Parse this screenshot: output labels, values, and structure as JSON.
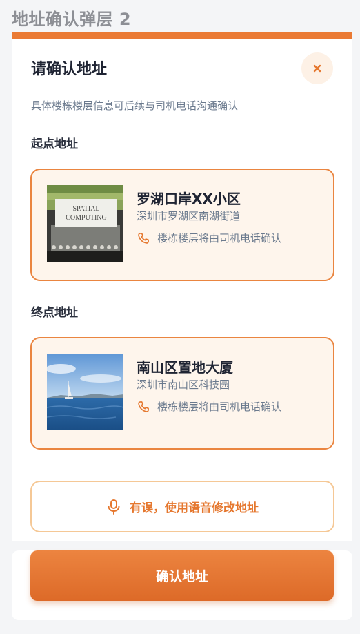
{
  "page": {
    "title": "地址确认弹层 2"
  },
  "sheet": {
    "title": "请确认地址",
    "subtitle": "具体楼栋楼层信息可后续与司机电话沟通确认"
  },
  "start": {
    "section_label": "起点地址",
    "name": "罗湖口岸XX小区",
    "detail": "深圳市罗湖区南湖街道",
    "phone_note": "楼栋楼层将由司机电话确认",
    "image_text": [
      "SPATIAL",
      "COMPUTING"
    ]
  },
  "end": {
    "section_label": "终点地址",
    "name": "南山区置地大厦",
    "detail": "深圳市南山区科技园",
    "phone_note": "楼栋楼层将由司机电话确认"
  },
  "voice_button": {
    "label": "有误，使用语音修改地址"
  },
  "confirm_button": {
    "label": "确认地址"
  },
  "icons": {
    "close": "close-icon",
    "phone": "phone-icon",
    "microphone": "microphone-icon"
  },
  "colors": {
    "accent": "#ea7a34",
    "card_bg": "#fef5ec",
    "card_border": "#ea8540"
  }
}
